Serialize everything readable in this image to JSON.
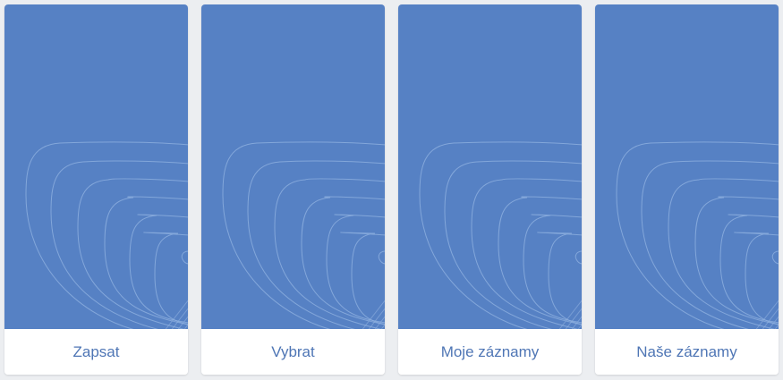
{
  "theme": {
    "card_color": "#5681c4",
    "contour_color": "#8fb0e0",
    "label_color": "#4f76b5"
  },
  "cards": [
    {
      "label": "Zapsat"
    },
    {
      "label": "Vybrat"
    },
    {
      "label": "Moje záznamy"
    },
    {
      "label": "Naše záznamy"
    }
  ]
}
